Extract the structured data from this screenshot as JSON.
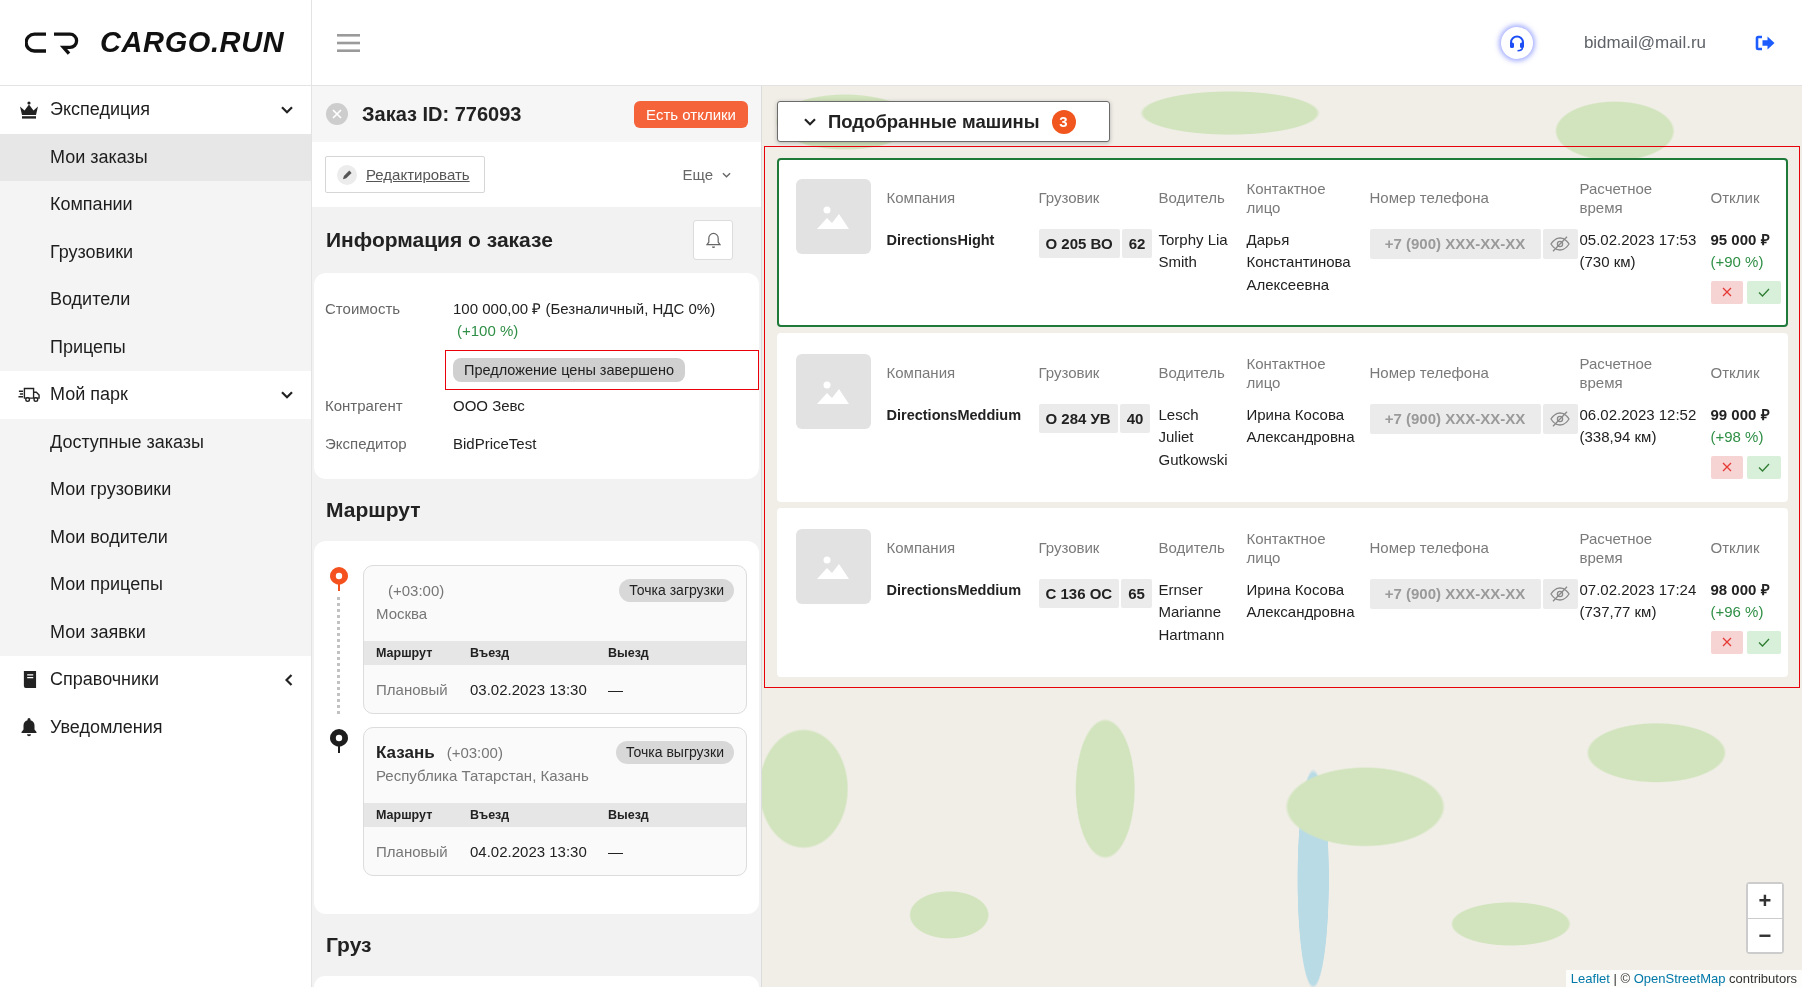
{
  "header": {
    "logo": "CARGO.RUN",
    "user_email": "bidmail@mail.ru"
  },
  "sidebar": {
    "items": [
      {
        "kind": "group",
        "label": "Экспедиция",
        "selected": false,
        "expanded": true,
        "children": [
          {
            "label": "Мои заказы",
            "selected": true
          },
          {
            "label": "Компании",
            "selected": false
          },
          {
            "label": "Грузовики",
            "selected": false
          },
          {
            "label": "Водители",
            "selected": false
          },
          {
            "label": "Прицепы",
            "selected": false
          }
        ]
      },
      {
        "kind": "group",
        "label": "Мой парк",
        "selected": false,
        "expanded": true,
        "children": [
          {
            "label": "Доступные заказы",
            "selected": false
          },
          {
            "label": "Мои грузовики",
            "selected": false
          },
          {
            "label": "Мои водители",
            "selected": false
          },
          {
            "label": "Мои прицепы",
            "selected": false
          },
          {
            "label": "Мои заявки",
            "selected": false
          }
        ]
      },
      {
        "kind": "group",
        "label": "Справочники",
        "selected": false,
        "expanded": false
      },
      {
        "kind": "link",
        "label": "Уведомления",
        "selected": false
      }
    ]
  },
  "order": {
    "title": "Заказ ID: 776093",
    "status_badge": "Есть отклики",
    "edit_button": "Редактировать",
    "more_menu": "Еще",
    "info": {
      "title": "Информация о заказе",
      "rows": [
        {
          "label": "Стоимость",
          "value": "100 000,00 ₽ (Безналичный, НДС 0%)",
          "change": "(+100 %)",
          "status": "Предложение цены завершено",
          "status_highlighted": true
        },
        {
          "label": "Контрагент",
          "value": "ООО Зевс"
        },
        {
          "label": "Экспедитор",
          "value": "BidPriceTest"
        }
      ]
    },
    "route": {
      "title": "Маршрут",
      "stops": [
        {
          "kind": "loading",
          "timezone": "(+03:00)",
          "address": "Москва",
          "tag": "Точка загрузки",
          "columns": [
            "Маршрут",
            "Въезд",
            "Выезд"
          ],
          "rows": [
            {
              "type": "Плановый",
              "entry": "03.02.2023 13:30",
              "exit": "—"
            }
          ]
        },
        {
          "kind": "unloading",
          "city": "Казань",
          "timezone": "(+03:00)",
          "address": "Республика Татарстан, Казань",
          "tag": "Точка выгрузки",
          "columns": [
            "Маршрут",
            "Въезд",
            "Выезд"
          ],
          "rows": [
            {
              "type": "Плановый",
              "entry": "04.02.2023 13:30",
              "exit": "—"
            }
          ]
        }
      ]
    },
    "cargo": {
      "title": "Груз"
    }
  },
  "matches": {
    "title": "Подобранные машины",
    "count": "3",
    "expanded": true,
    "highlighted": true,
    "cards": [
      {
        "selected": true,
        "columns": [
          "Компания",
          "Грузовик",
          "Водитель",
          "Контактное лицо",
          "Номер телефона",
          "Расчетное время",
          "Отклик"
        ],
        "company": "DirectionsHight",
        "plate": "О 205 ВО",
        "region": "62",
        "driver": "Torphy Lia Smith",
        "contact": "Дарья Константинова Алексеевна",
        "phone": "+7 (900) XXX-XX-XX",
        "phone_hidden": true,
        "eta": "05.02.2023 17:53",
        "distance": "(730 км)",
        "price": "95 000 ₽",
        "price_change": "(+90 %)"
      },
      {
        "selected": false,
        "columns": [
          "Компания",
          "Грузовик",
          "Водитель",
          "Контактное лицо",
          "Номер телефона",
          "Расчетное время",
          "Отклик"
        ],
        "company": "DirectionsMeddium",
        "plate": "О 284 УВ",
        "region": "40",
        "driver": "Lesch Juliet Gutkowski",
        "contact": "Ирина Косова Александровна",
        "phone": "+7 (900) XXX-XX-XX",
        "phone_hidden": true,
        "eta": "06.02.2023 12:52",
        "distance": "(338,94 км)",
        "price": "99 000 ₽",
        "price_change": "(+98 %)"
      },
      {
        "selected": false,
        "columns": [
          "Компания",
          "Грузовик",
          "Водитель",
          "Контактное лицо",
          "Номер телефона",
          "Расчетное время",
          "Отклик"
        ],
        "company": "DirectionsMeddium",
        "plate": "С 136 ОС",
        "region": "65",
        "driver": "Ernser Marianne Hartmann",
        "contact": "Ирина Косова Александровна",
        "phone": "+7 (900) XXX-XX-XX",
        "phone_hidden": true,
        "eta": "07.02.2023 17:24",
        "distance": "(737,77 км)",
        "price": "98 000 ₽",
        "price_change": "(+96 %)"
      }
    ]
  },
  "map": {
    "zoom_in": "+",
    "zoom_out": "−",
    "attribution": {
      "leaflet": "Leaflet",
      "separator": "| ©",
      "osm": "OpenStreetMap",
      "suffix": "contributors"
    }
  }
}
